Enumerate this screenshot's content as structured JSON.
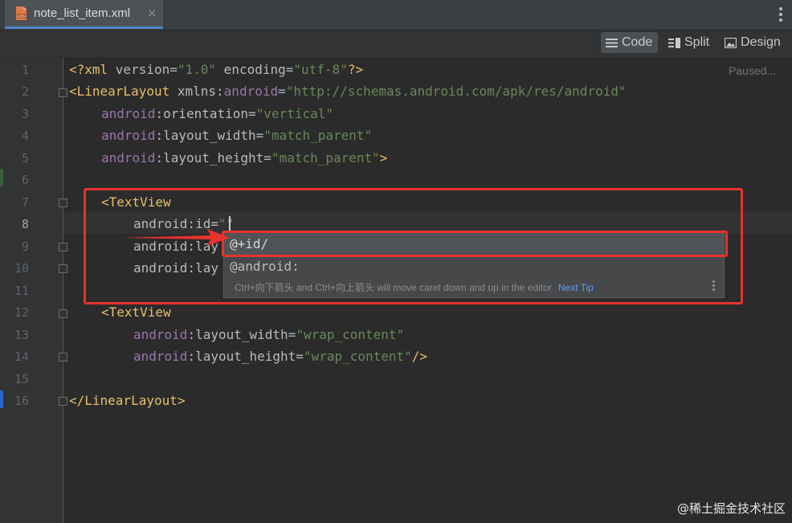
{
  "tab": {
    "title": "note_list_item.xml",
    "close": "×",
    "icon": "xml-file-icon"
  },
  "view_modes": {
    "code": "Code",
    "split": "Split",
    "design": "Design",
    "active": "Code"
  },
  "status": {
    "paused": "Paused..."
  },
  "line_numbers": [
    "1",
    "2",
    "3",
    "4",
    "5",
    "6",
    "7",
    "8",
    "9",
    "10",
    "11",
    "12",
    "13",
    "14",
    "15",
    "16"
  ],
  "current_line": "8",
  "code": {
    "l1": {
      "open": "<?xml ",
      "a1": "version",
      "eq1": "=",
      "v1": "\"1.0\"",
      "a2": " encoding",
      "eq2": "=",
      "v2": "\"utf-8\"",
      "close": "?>"
    },
    "l2": {
      "tag": "<LinearLayout",
      "ns_attr": " xmlns",
      "colon": ":",
      "ns_name": "android",
      "eq": "=",
      "value": "\"http://schemas.android.com/apk/res/android\""
    },
    "l3": {
      "ns": "android",
      "attr": ":orientation",
      "eq": "=",
      "value": "\"vertical\""
    },
    "l4": {
      "ns": "android",
      "attr": ":layout_width",
      "eq": "=",
      "value": "\"match_parent\""
    },
    "l5": {
      "ns": "android",
      "attr": ":layout_height",
      "eq": "=",
      "value": "\"match_parent\"",
      "close": ">"
    },
    "l7": {
      "tag": "<TextView"
    },
    "l8": {
      "text": "android:id=",
      "value": "\"\""
    },
    "l9": {
      "text": "android:lay"
    },
    "l10": {
      "text": "android:lay"
    },
    "l12": {
      "tag": "<TextView"
    },
    "l13": {
      "ns": "android",
      "attr": ":layout_width",
      "eq": "=",
      "value": "\"wrap_content\""
    },
    "l14": {
      "ns": "android",
      "attr": ":layout_height",
      "eq": "=",
      "value": "\"wrap_content\"",
      "close": "/>"
    },
    "l16": {
      "tag": "</LinearLayout>"
    }
  },
  "completion": {
    "options": [
      "@+id/",
      "@android:"
    ],
    "hint": "Ctrl+向下箭头 and Ctrl+向上箭头 will move caret down and up in the editor",
    "next_tip": "Next Tip"
  },
  "watermark": "@稀土掘金技术社区",
  "colors": {
    "annotation_red": "#e8322c",
    "accent_blue": "#4a88c7"
  }
}
